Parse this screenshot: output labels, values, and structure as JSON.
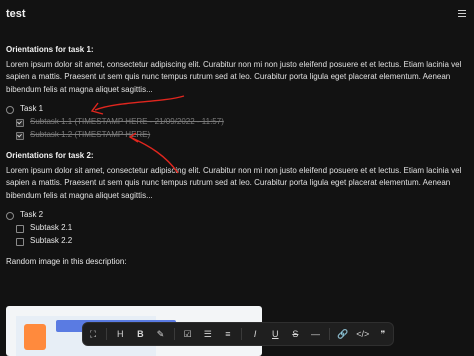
{
  "app": {
    "title": "test"
  },
  "sections": [
    {
      "title": "Orientations for task 1:",
      "text": "Lorem ipsum dolor sit amet, consectetur adipiscing elit. Curabitur non mi non justo eleifend posuere et et lectus. Etiam lacinia vel sapien a mattis. Praesent ut sem quis nunc tempus rutrum sed at leo. Curabitur porta ligula eget placerat elementum. Aenean bibendum felis at magna aliquet sagittis..."
    },
    {
      "title": "Orientations for task 2:",
      "text": "Lorem ipsum dolor sit amet, consectetur adipiscing elit. Curabitur non mi non justo eleifend posuere et et lectus. Etiam lacinia vel sapien a mattis. Praesent ut sem quis nunc tempus rutrum sed at leo. Curabitur porta ligula eget placerat elementum. Aenean bibendum felis at magna aliquet sagittis..."
    }
  ],
  "tasks": [
    {
      "label": "Task 1",
      "subtasks": [
        {
          "label": "Subtask 1.1 (TIMESTAMP HERE - 21/09/2022 - 11:57)",
          "checked": true
        },
        {
          "label": "Subtask 1.2 (TIMESTAMP HERE)",
          "checked": true
        }
      ]
    },
    {
      "label": "Task 2",
      "subtasks": [
        {
          "label": "Subtask 2.1",
          "checked": false
        },
        {
          "label": "Subtask 2.2",
          "checked": false
        }
      ]
    }
  ],
  "image_caption": "Random image in this description:",
  "toolbar": {
    "tools": [
      "fullscreen-icon",
      "heading-icon",
      "bold-icon",
      "highlight-icon",
      "checkbox-icon",
      "bullet-list-icon",
      "numbered-list-icon",
      "italic-icon",
      "underline-icon",
      "strike-icon",
      "divider-icon",
      "link-icon",
      "code-icon",
      "quote-icon"
    ]
  },
  "colors": {
    "background": "#121212",
    "text": "#e8e8e8",
    "annotation_red": "#e0261e"
  }
}
